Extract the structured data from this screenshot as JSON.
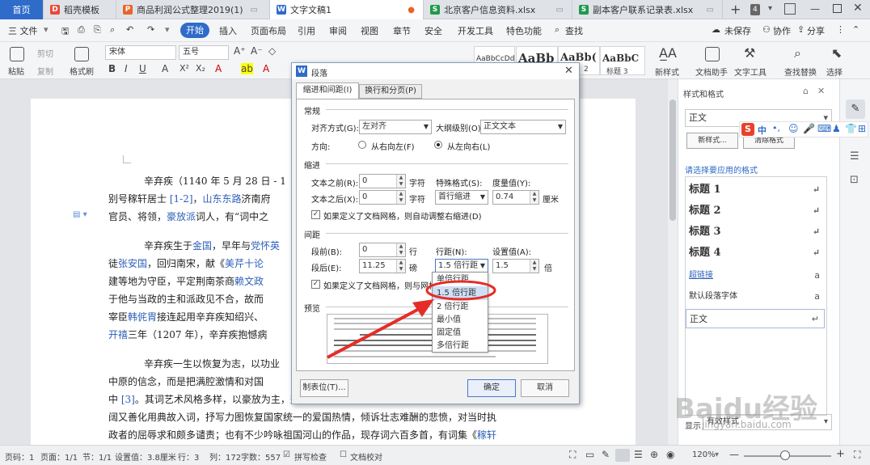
{
  "tabs": [
    {
      "label": "首页"
    },
    {
      "label": "稻壳模板",
      "icon": "docer-icon"
    },
    {
      "label": "商品利润公式整理2019(1)",
      "icon": "ppt-file-icon"
    },
    {
      "label": "文字文稿1",
      "icon": "writer-file-icon"
    },
    {
      "label": "北京客户信息资料.xlsx",
      "icon": "sheet-file-icon"
    },
    {
      "label": "副本客户联系记录表.xlsx",
      "icon": "sheet-file-icon"
    }
  ],
  "tab_count": "4",
  "menu": {
    "file": "三 文件",
    "items": [
      "开始",
      "插入",
      "页面布局",
      "引用",
      "审阅",
      "视图",
      "章节",
      "安全",
      "开发工具",
      "特色功能"
    ],
    "search": "查找",
    "unsaved": "未保存",
    "collab": "协作",
    "share": "分享"
  },
  "ribbon": {
    "paste": "粘贴",
    "cut": "剪切",
    "copy": "复制",
    "format_painter": "格式刷",
    "font_name": "宋体",
    "font_size": "五号",
    "styles": [
      "AaBbCcDd",
      "AaBb",
      "AaBb(",
      "AaBbC"
    ],
    "style_labels": [
      "2",
      "标题 3"
    ],
    "new_style": "新样式",
    "assistant": "文档助手",
    "text_tools": "文字工具",
    "find_replace": "查找替换",
    "select": "选择"
  },
  "document": {
    "lines": [
      {
        "segments": [
          {
            "t": "辛弃疾（1140 年 5 月 28 日 - 1"
          }
        ]
      },
      {
        "segments": [
          {
            "t": "别号稼轩居士 "
          },
          {
            "t": "[1-2]",
            "link": true
          },
          {
            "t": "，"
          },
          {
            "t": "山东东路",
            "link": true
          },
          {
            "t": "济南府"
          }
        ]
      },
      {
        "segments": [
          {
            "t": "官员、将领，"
          },
          {
            "t": "豪放派",
            "link": true
          },
          {
            "t": "词人，有“词中之"
          }
        ]
      },
      {
        "segments": [
          {
            "t": "辛弃疾生于"
          },
          {
            "t": "金国",
            "link": true
          },
          {
            "t": "，早年与"
          },
          {
            "t": "党怀英",
            "link": true
          }
        ]
      },
      {
        "segments": [
          {
            "t": "徒"
          },
          {
            "t": "张安国",
            "link": true
          },
          {
            "t": "，回归南宋，献《"
          },
          {
            "t": "美芹十论",
            "link": true
          }
        ]
      },
      {
        "segments": [
          {
            "t": "建等地为守臣，平定荆南茶商"
          },
          {
            "t": "赖文政",
            "link": true
          }
        ]
      },
      {
        "segments": [
          {
            "t": "于他与当政的主和派政见不合，故而"
          }
        ]
      },
      {
        "segments": [
          {
            "t": "宰臣"
          },
          {
            "t": "韩侂胄",
            "link": true
          },
          {
            "t": "接连起用辛弃疾知绍兴、"
          }
        ]
      },
      {
        "segments": [
          {
            "t": "开禧",
            "link": true
          },
          {
            "t": "三年（1207 年），辛弃疾抱憾病"
          }
        ]
      },
      {
        "segments": [
          {
            "t": "辛弃疾一生以恢复为志，以功业"
          }
        ]
      },
      {
        "segments": [
          {
            "t": "中原的信念，而是把满腔激情和对国"
          }
        ]
      },
      {
        "segments": [
          {
            "t": "中 "
          },
          {
            "t": "[3]",
            "link": true
          },
          {
            "t": "。其词艺术风格多样，以豪放为主，兼有清丽婉约之作。其词题材"
          }
        ]
      },
      {
        "segments": [
          {
            "t": "阔又善化用典故入词，抒写力图恢复国家统一的爱国热情，倾诉壮志难酬的悲愤，对当时执"
          }
        ]
      },
      {
        "segments": [
          {
            "t": "政者的屈辱求和颇多谴责；也有不少吟咏祖国河山的作品，现存词六百多首，有词集《"
          },
          {
            "t": "稼轩",
            "link": true
          }
        ]
      }
    ]
  },
  "dialog": {
    "title": "段落",
    "tabs": [
      "缩进和间距(I)",
      "换行和分页(P)"
    ],
    "general": "常规",
    "alignment_label": "对齐方式(G):",
    "alignment_value": "左对齐",
    "outline_label": "大纲级别(O):",
    "outline_value": "正文文本",
    "direction_label": "方向:",
    "rtl": "从右向左(F)",
    "ltr": "从左向右(L)",
    "indent": "缩进",
    "before_text_label": "文本之前(R):",
    "before_text_value": "0",
    "unit_char": "字符",
    "after_text_label": "文本之后(X):",
    "after_text_value": "0",
    "special_label": "特殊格式(S):",
    "special_value": "首行缩进",
    "measure_label": "度量值(Y):",
    "measure_value": "0.74",
    "measure_unit": "厘米",
    "auto_indent": "如果定义了文档网格，则自动调整右缩进(D)",
    "spacing": "间距",
    "before_label": "段前(B):",
    "before_value": "0",
    "before_unit": "行",
    "after_label": "段后(E):",
    "after_value": "11.25",
    "after_unit": "磅",
    "line_spacing_label": "行距(N):",
    "line_spacing_value": "1.5 倍行距",
    "set_value_label": "设置值(A):",
    "set_value": "1.5",
    "set_unit": "倍",
    "grid_align": "如果定义了文档网格，则与网格对齐",
    "preview": "预览",
    "tabs_button": "制表位(T)...",
    "ok": "确定",
    "cancel": "取消"
  },
  "line_spacing_options": [
    "单倍行距",
    "1.5 倍行距",
    "2 倍行距",
    "最小值",
    "固定值",
    "多倍行距"
  ],
  "taskpane": {
    "title": "样式和格式",
    "current": "正文",
    "new_style": "新样式...",
    "clear_format": "清除格式",
    "apply_label": "请选择要应用的格式",
    "styles": [
      "标题 1",
      "标题 2",
      "标题 3",
      "标题 4",
      "超链接",
      "默认段落字体",
      "正文"
    ],
    "show_label": "显示：",
    "show_value": "有效样式"
  },
  "ime": {
    "label": "中"
  },
  "status": {
    "page_num": "页码：1",
    "page": "页面：1/1",
    "section": "节：1/1",
    "setting": "设置值：3.8厘米",
    "row": "行：3",
    "col": "列：172",
    "words": "字数：557",
    "spell": "拼写检查",
    "proof": "文档校对",
    "zoom": "120%"
  },
  "watermark": "Baidu经验",
  "watermark_url": "jingyan.baidu.com",
  "colors": {
    "accent": "#2f6bc9",
    "annotation": "#e52d27",
    "link": "#2d5fb9"
  }
}
